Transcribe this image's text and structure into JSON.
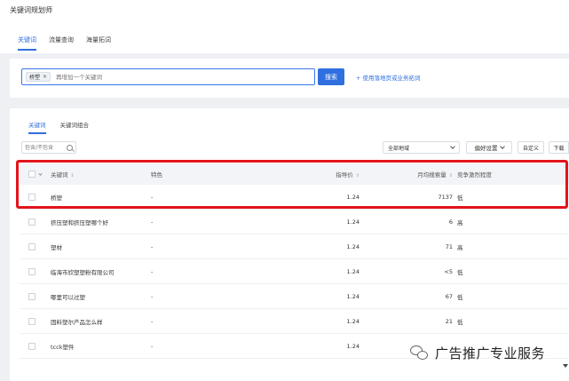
{
  "app": {
    "title": "关键词规划师"
  },
  "tabs": [
    {
      "label": "关键词",
      "active": true
    },
    {
      "label": "流量查询",
      "active": false
    },
    {
      "label": "海量拓词",
      "active": false
    }
  ],
  "search": {
    "chip": "桥塑",
    "placeholder": "再增加一个关键词",
    "button_label": "搜索",
    "landing_link": "+ 使用落地页或业务拓词"
  },
  "results": {
    "sub_tabs": [
      {
        "label": "关键词",
        "active": true
      },
      {
        "label": "关键词组合",
        "active": false
      }
    ],
    "filter_placeholder": "包含/不包含",
    "region_select": "全部地域",
    "pref_button": "偏好设置",
    "custom_button": "自定义",
    "download_button": "下载",
    "columns": {
      "keyword": "关键词",
      "feature": "特色",
      "bid": "指导价",
      "volume": "月均搜索量",
      "competition": "竞争激烈程度"
    },
    "rows": [
      {
        "keyword": "桥塑",
        "feature": "-",
        "bid": "1.24",
        "volume": "7137",
        "competition": "低"
      },
      {
        "keyword": "挤压塑和挤压塑哪个好",
        "feature": "-",
        "bid": "1.24",
        "volume": "6",
        "competition": "高"
      },
      {
        "keyword": "塑材",
        "feature": "-",
        "bid": "1.24",
        "volume": "71",
        "competition": "高"
      },
      {
        "keyword": "临海市欣塑塑粉有限公司",
        "feature": "-",
        "bid": "1.24",
        "volume": "<5",
        "competition": "低"
      },
      {
        "keyword": "哪里可以过塑",
        "feature": "-",
        "bid": "1.24",
        "volume": "67",
        "competition": "低"
      },
      {
        "keyword": "固料塑尔产品怎么样",
        "feature": "-",
        "bid": "1.24",
        "volume": "21",
        "competition": "低"
      },
      {
        "keyword": "tcck塑件",
        "feature": "-",
        "bid": "1.24",
        "volume": "",
        "competition": ""
      }
    ]
  },
  "watermark": {
    "text": "广告推广专业服务"
  },
  "colors": {
    "accent": "#2f6fe0",
    "highlight": "#e3141b"
  }
}
